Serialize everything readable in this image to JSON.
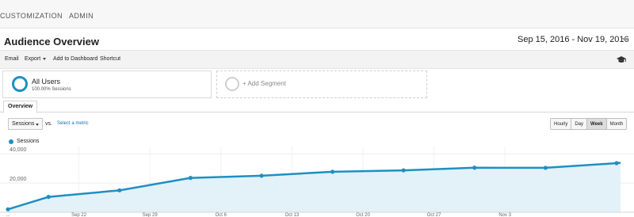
{
  "topnav": {
    "tabs": [
      "CUSTOMIZATION",
      "ADMIN"
    ]
  },
  "page": {
    "title": "Audience Overview"
  },
  "date_range": {
    "label": "Sep 15, 2016 - Nov 19, 2016"
  },
  "toolbar": {
    "email_label": "Email",
    "export_label": "Export",
    "dashboard_label": "Add to Dashboard",
    "shortcut_label": "Shortcut"
  },
  "segments": {
    "active": {
      "name": "All Users",
      "subtitle": "100.00% Sessions"
    },
    "add_label": "+ Add Segment"
  },
  "overview_tab": {
    "label": "Overview"
  },
  "metric": {
    "selected": "Sessions",
    "vs_label": "vs.",
    "select_metric_label": "Select a metric"
  },
  "granularity": {
    "options": [
      "Hourly",
      "Day",
      "Week",
      "Month"
    ],
    "selected": "Week"
  },
  "colors": {
    "accent": "#1f8fc2",
    "area_fill": "#e3f1f9",
    "link": "#1a6fb5"
  },
  "chart_data": {
    "type": "area",
    "series": [
      {
        "name": "Sessions",
        "x": [
          "2016-09-15",
          "2016-09-19",
          "2016-09-26",
          "2016-10-03",
          "2016-10-10",
          "2016-10-17",
          "2016-10-24",
          "2016-10-31",
          "2016-11-07",
          "2016-11-14"
        ],
        "values": [
          2000,
          10500,
          15000,
          23500,
          25000,
          27700,
          28700,
          30500,
          30400,
          33600
        ]
      }
    ],
    "y_ticks": [
      "40,000",
      "20,000"
    ],
    "y_tick_values": [
      40000,
      20000
    ],
    "x_ticks": [
      "Sep 22",
      "Sep 29",
      "Oct 6",
      "Oct 13",
      "Oct 20",
      "Oct 27",
      "Nov 3"
    ],
    "x_tick_dates": [
      "2016-09-22",
      "2016-09-29",
      "2016-10-06",
      "2016-10-13",
      "2016-10-20",
      "2016-10-27",
      "2016-11-03"
    ],
    "first_x_tick": "...",
    "ylim": [
      0,
      45000
    ],
    "grid": true,
    "legend": "top-left"
  }
}
